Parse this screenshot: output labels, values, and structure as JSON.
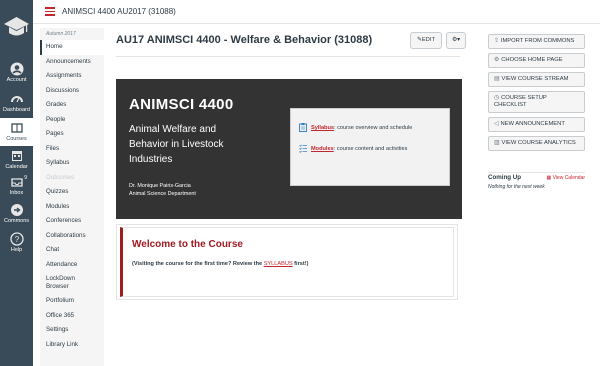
{
  "breadcrumb": "ANIMSCI 4400 AU2017 (31088)",
  "global_nav": {
    "items": [
      {
        "label": "Account",
        "icon": "account-icon"
      },
      {
        "label": "Dashboard",
        "icon": "dashboard-icon"
      },
      {
        "label": "Courses",
        "icon": "courses-icon"
      },
      {
        "label": "Calendar",
        "icon": "calendar-icon"
      },
      {
        "label": "Inbox",
        "icon": "inbox-icon",
        "badge": "9"
      },
      {
        "label": "Commons",
        "icon": "commons-icon"
      },
      {
        "label": "Help",
        "icon": "help-icon"
      }
    ]
  },
  "course_nav": {
    "term": "Autumn 2017",
    "links": [
      "Home",
      "Announcements",
      "Assignments",
      "Discussions",
      "Grades",
      "People",
      "Pages",
      "Files",
      "Syllabus",
      "Outcomes",
      "Quizzes",
      "Modules",
      "Conferences",
      "Collaborations",
      "Chat",
      "Attendance",
      "LockDown Browser",
      "Portfolium",
      "Office 365",
      "Settings",
      "Library Link"
    ]
  },
  "main": {
    "title": "AU17 ANIMSCI 4400 - Welfare & Behavior (31088)",
    "edit_label": "EDIT",
    "banner": {
      "code": "ANIMSCI 4400",
      "title": "Animal Welfare and Behavior in Livestock Industries",
      "instructor": "Dr. Monique Pairis-Garcia",
      "department": "Animal Science Department",
      "syllabus_link": "Syllabus",
      "syllabus_text": ": course overview and schedule",
      "modules_link": "Modules",
      "modules_text": ": course content and activities"
    },
    "welcome": {
      "heading": "Welcome to the Course",
      "text_before": "(Visiting the course for the first time? Review the ",
      "link": "SYLLABUS",
      "text_after": " first!)"
    }
  },
  "sidebar": {
    "buttons": [
      {
        "label": "IMPORT FROM COMMONS",
        "icon": "import-icon"
      },
      {
        "label": "CHOOSE HOME PAGE",
        "icon": "home-page-icon"
      },
      {
        "label": "VIEW COURSE STREAM",
        "icon": "stream-icon"
      },
      {
        "label": "COURSE SETUP CHECKLIST",
        "icon": "checklist-icon"
      },
      {
        "label": "NEW ANNOUNCEMENT",
        "icon": "announcement-icon"
      },
      {
        "label": "VIEW COURSE ANALYTICS",
        "icon": "analytics-icon"
      }
    ],
    "coming_up": "Coming Up",
    "view_calendar": "View Calendar",
    "nothing": "Nothing for the next week"
  },
  "colors": {
    "nav_bg": "#394b58",
    "accent": "#c3262f",
    "banner_bg": "#333333"
  }
}
